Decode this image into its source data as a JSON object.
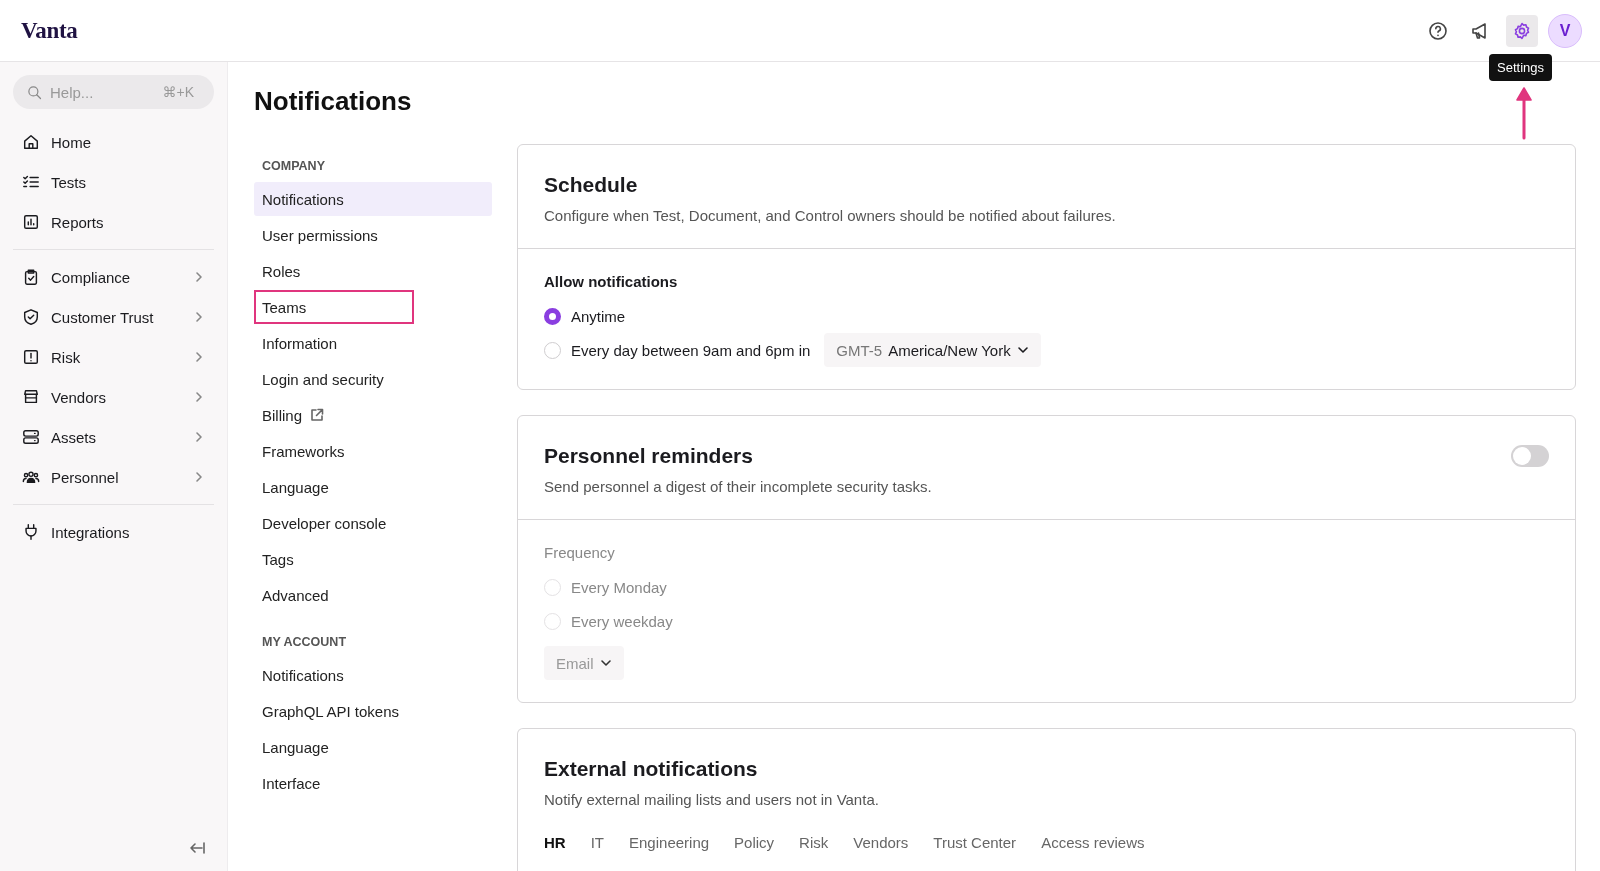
{
  "header": {
    "logo": "Vanta",
    "avatar": "V",
    "tooltip": "Settings"
  },
  "sidebar": {
    "search": {
      "placeholder": "Help...",
      "shortcut": "⌘+K"
    },
    "groups": [
      [
        {
          "label": "Home",
          "expandable": false
        },
        {
          "label": "Tests",
          "expandable": false
        },
        {
          "label": "Reports",
          "expandable": false
        }
      ],
      [
        {
          "label": "Compliance",
          "expandable": true
        },
        {
          "label": "Customer Trust",
          "expandable": true
        },
        {
          "label": "Risk",
          "expandable": true
        },
        {
          "label": "Vendors",
          "expandable": true
        },
        {
          "label": "Assets",
          "expandable": true
        },
        {
          "label": "Personnel",
          "expandable": true
        }
      ],
      [
        {
          "label": "Integrations",
          "expandable": false
        }
      ]
    ]
  },
  "page": {
    "title": "Notifications"
  },
  "settings_nav": [
    {
      "heading": "COMPANY",
      "items": [
        {
          "label": "Notifications",
          "selected": true,
          "highlighted": false,
          "external": false
        },
        {
          "label": "User permissions",
          "selected": false,
          "highlighted": false,
          "external": false
        },
        {
          "label": "Roles",
          "selected": false,
          "highlighted": false,
          "external": false
        },
        {
          "label": "Teams",
          "selected": false,
          "highlighted": true,
          "external": false
        },
        {
          "label": "Information",
          "selected": false,
          "highlighted": false,
          "external": false
        },
        {
          "label": "Login and security",
          "selected": false,
          "highlighted": false,
          "external": false
        },
        {
          "label": "Billing",
          "selected": false,
          "highlighted": false,
          "external": true
        },
        {
          "label": "Frameworks",
          "selected": false,
          "highlighted": false,
          "external": false
        },
        {
          "label": "Language",
          "selected": false,
          "highlighted": false,
          "external": false
        },
        {
          "label": "Developer console",
          "selected": false,
          "highlighted": false,
          "external": false
        },
        {
          "label": "Tags",
          "selected": false,
          "highlighted": false,
          "external": false
        },
        {
          "label": "Advanced",
          "selected": false,
          "highlighted": false,
          "external": false
        }
      ]
    },
    {
      "heading": "MY ACCOUNT",
      "items": [
        {
          "label": "Notifications",
          "selected": false,
          "highlighted": false,
          "external": false
        },
        {
          "label": "GraphQL API tokens",
          "selected": false,
          "highlighted": false,
          "external": false
        },
        {
          "label": "Language",
          "selected": false,
          "highlighted": false,
          "external": false
        },
        {
          "label": "Interface",
          "selected": false,
          "highlighted": false,
          "external": false
        }
      ]
    }
  ],
  "cards": [
    {
      "kind": "schedule",
      "title": "Schedule",
      "description": "Configure when Test, Document, and Control owners should be notified about failures.",
      "label": "Allow notifications",
      "disabled": false,
      "options": [
        {
          "label": "Anytime",
          "selected": true
        },
        {
          "label": "Every day between 9am and 6pm in",
          "selected": false,
          "timezone": {
            "offset": "GMT-5",
            "zone": "America/New York"
          }
        }
      ]
    },
    {
      "kind": "reminders",
      "title": "Personnel reminders",
      "description": "Send personnel a digest of their incomplete security tasks.",
      "toggle": {
        "on": false
      },
      "label": "Frequency",
      "disabled": true,
      "options": [
        {
          "label": "Every Monday",
          "selected": false
        },
        {
          "label": "Every weekday",
          "selected": false
        }
      ],
      "channel": "Email"
    },
    {
      "kind": "external",
      "title": "External notifications",
      "description": "Notify external mailing lists and users not in Vanta.",
      "tabs": [
        {
          "label": "HR",
          "selected": true
        },
        {
          "label": "IT",
          "selected": false
        },
        {
          "label": "Engineering",
          "selected": false
        },
        {
          "label": "Policy",
          "selected": false
        },
        {
          "label": "Risk",
          "selected": false
        },
        {
          "label": "Vendors",
          "selected": false
        },
        {
          "label": "Trust Center",
          "selected": false
        },
        {
          "label": "Access reviews",
          "selected": false
        }
      ]
    }
  ]
}
